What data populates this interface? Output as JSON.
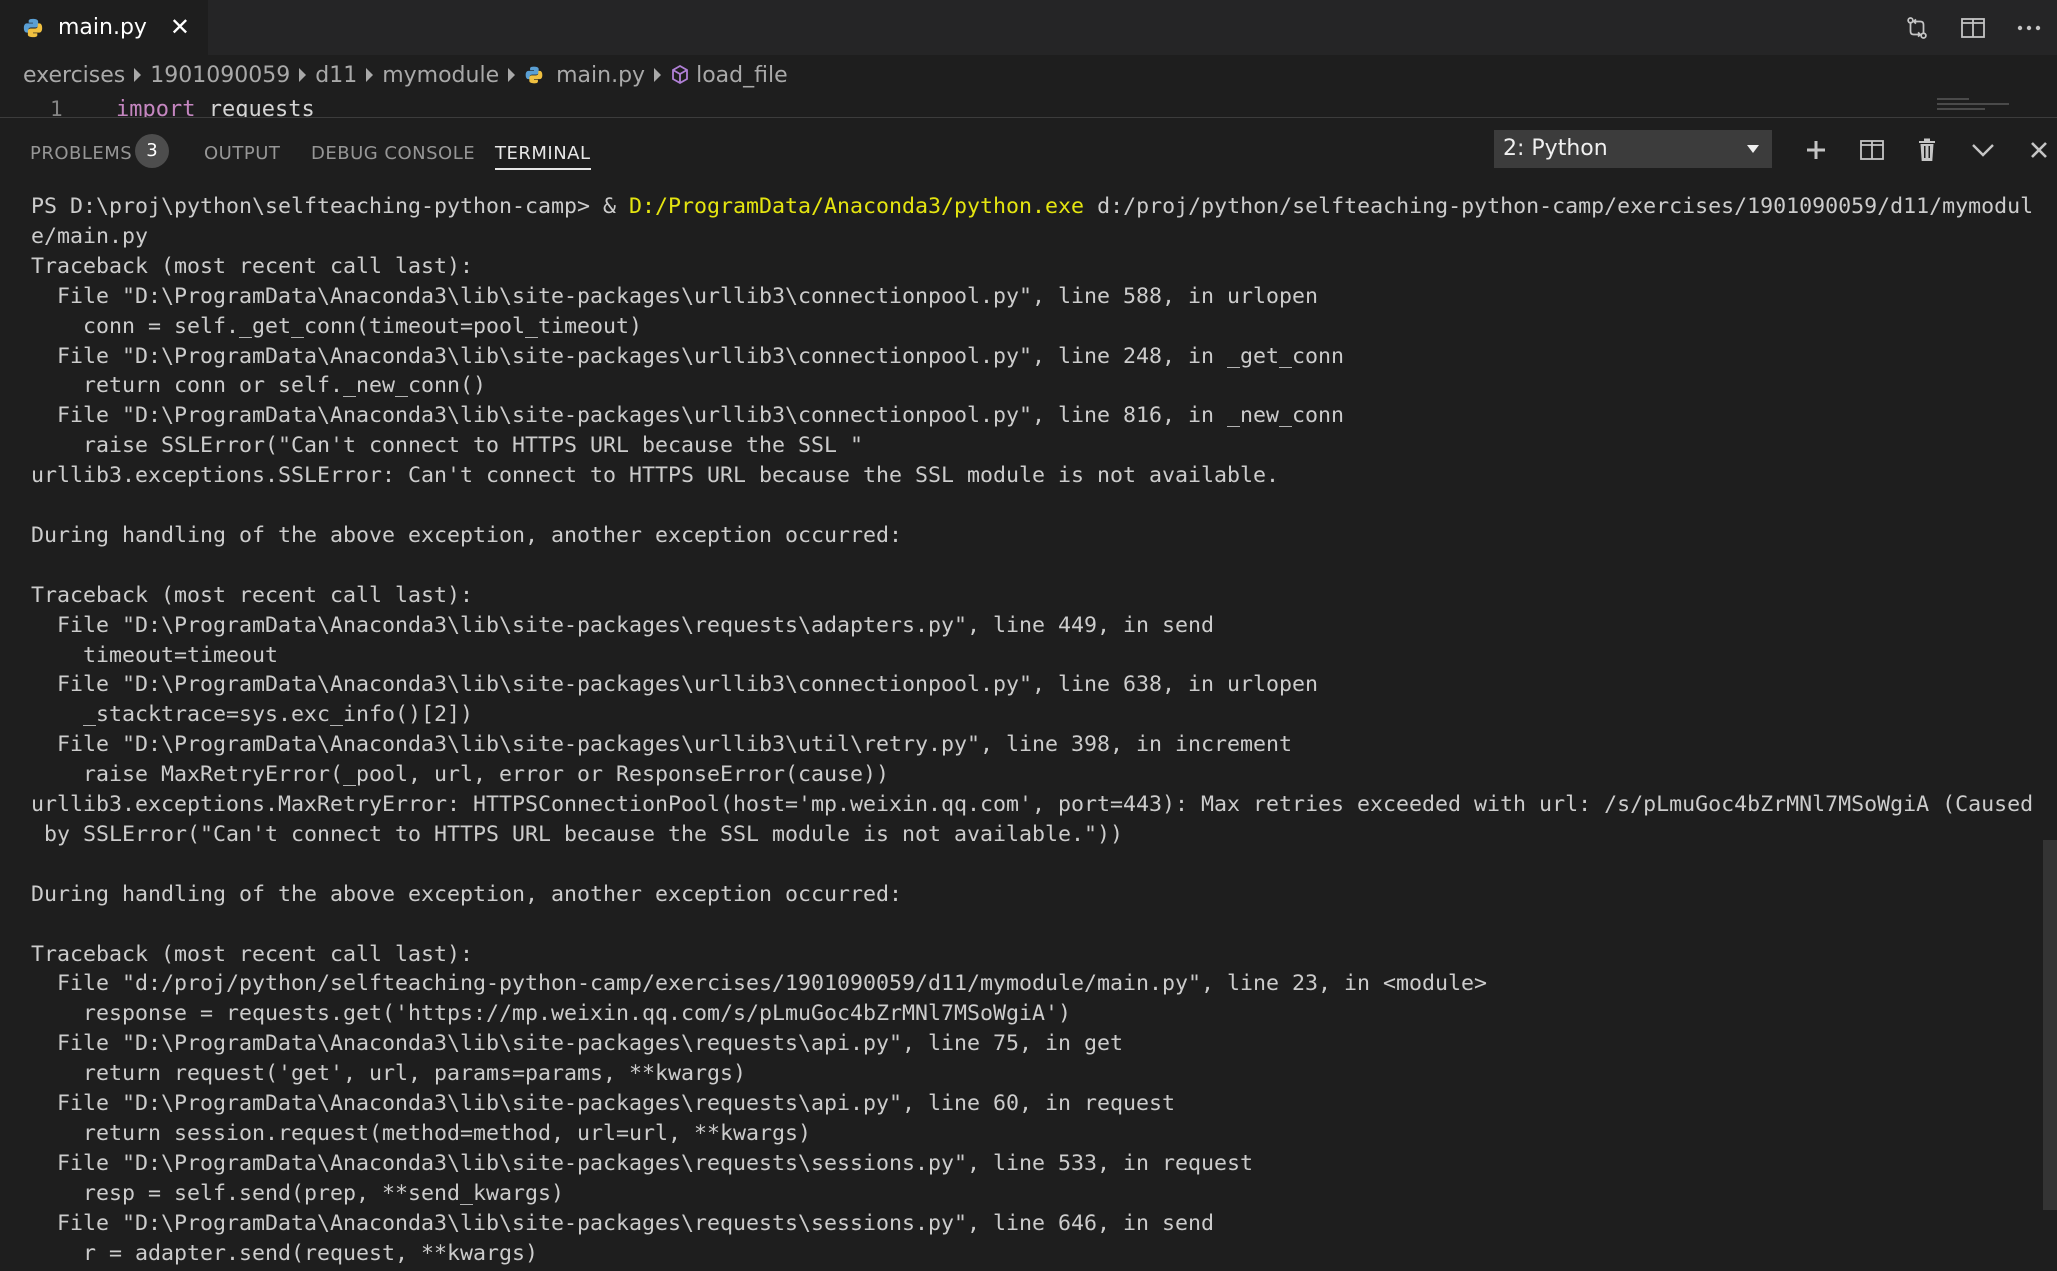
{
  "tab": {
    "label": "main.py",
    "close": "✕"
  },
  "tab_actions": [
    "compare-changes-icon",
    "split-editor-icon",
    "more-actions-icon"
  ],
  "breadcrumb": {
    "items": [
      "exercises",
      "1901090059",
      "d11",
      "mymodule",
      "main.py",
      "load_file"
    ]
  },
  "editor": {
    "line_number": "1",
    "keyword": "import",
    "module": " requests"
  },
  "panel": {
    "tabs": {
      "problems": "PROBLEMS",
      "output": "OUTPUT",
      "debug": "DEBUG CONSOLE",
      "terminal": "TERMINAL"
    },
    "problems_count": "3",
    "terminal_select": "2: Python"
  },
  "terminal": {
    "prompt": "PS D:\\proj\\python\\selfteaching-python-camp> & ",
    "exe": "D:/ProgramData/Anaconda3/python.exe",
    "arg": " d:/proj/python/selfteaching-python-camp/exercises/1901090059/d11/mymodul",
    "lines": [
      "e/main.py",
      "Traceback (most recent call last):",
      "  File \"D:\\ProgramData\\Anaconda3\\lib\\site-packages\\urllib3\\connectionpool.py\", line 588, in urlopen",
      "    conn = self._get_conn(timeout=pool_timeout)",
      "  File \"D:\\ProgramData\\Anaconda3\\lib\\site-packages\\urllib3\\connectionpool.py\", line 248, in _get_conn",
      "    return conn or self._new_conn()",
      "  File \"D:\\ProgramData\\Anaconda3\\lib\\site-packages\\urllib3\\connectionpool.py\", line 816, in _new_conn",
      "    raise SSLError(\"Can't connect to HTTPS URL because the SSL \"",
      "urllib3.exceptions.SSLError: Can't connect to HTTPS URL because the SSL module is not available.",
      "",
      "During handling of the above exception, another exception occurred:",
      "",
      "Traceback (most recent call last):",
      "  File \"D:\\ProgramData\\Anaconda3\\lib\\site-packages\\requests\\adapters.py\", line 449, in send",
      "    timeout=timeout",
      "  File \"D:\\ProgramData\\Anaconda3\\lib\\site-packages\\urllib3\\connectionpool.py\", line 638, in urlopen",
      "    _stacktrace=sys.exc_info()[2])",
      "  File \"D:\\ProgramData\\Anaconda3\\lib\\site-packages\\urllib3\\util\\retry.py\", line 398, in increment",
      "    raise MaxRetryError(_pool, url, error or ResponseError(cause))",
      "urllib3.exceptions.MaxRetryError: HTTPSConnectionPool(host='mp.weixin.qq.com', port=443): Max retries exceeded with url: /s/pLmuGoc4bZrMNl7MSoWgiA (Caused",
      " by SSLError(\"Can't connect to HTTPS URL because the SSL module is not available.\"))",
      "",
      "During handling of the above exception, another exception occurred:",
      "",
      "Traceback (most recent call last):",
      "  File \"d:/proj/python/selfteaching-python-camp/exercises/1901090059/d11/mymodule/main.py\", line 23, in <module>",
      "    response = requests.get('https://mp.weixin.qq.com/s/pLmuGoc4bZrMNl7MSoWgiA')",
      "  File \"D:\\ProgramData\\Anaconda3\\lib\\site-packages\\requests\\api.py\", line 75, in get",
      "    return request('get', url, params=params, **kwargs)",
      "  File \"D:\\ProgramData\\Anaconda3\\lib\\site-packages\\requests\\api.py\", line 60, in request",
      "    return session.request(method=method, url=url, **kwargs)",
      "  File \"D:\\ProgramData\\Anaconda3\\lib\\site-packages\\requests\\sessions.py\", line 533, in request",
      "    resp = self.send(prep, **send_kwargs)",
      "  File \"D:\\ProgramData\\Anaconda3\\lib\\site-packages\\requests\\sessions.py\", line 646, in send",
      "    r = adapter.send(request, **kwargs)"
    ]
  },
  "colors": {
    "background": "#1e1e1e",
    "tabbar": "#252526",
    "exe_highlight": "#e5e510",
    "python_blue": "#3572A5",
    "python_yellow": "#f0c040"
  }
}
